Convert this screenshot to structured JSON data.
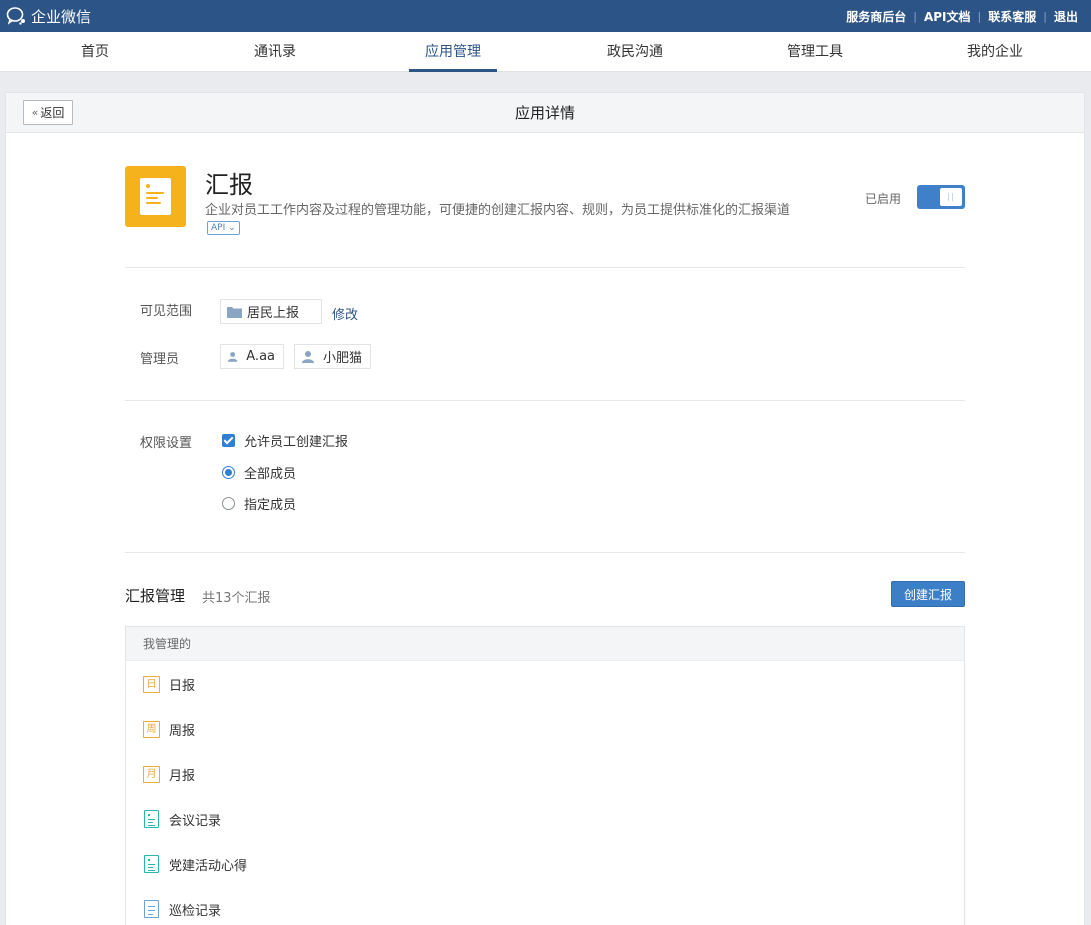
{
  "topbar": {
    "logo_text": "企业微信",
    "links": [
      "服务商后台",
      "API文档",
      "联系客服",
      "退出"
    ]
  },
  "nav": {
    "tabs": [
      "首页",
      "通讯录",
      "应用管理",
      "政民沟通",
      "管理工具",
      "我的企业"
    ],
    "active": "应用管理"
  },
  "page": {
    "back_label": "返回",
    "title": "应用详情"
  },
  "app": {
    "name": "汇报",
    "description": "企业对员工工作内容及过程的管理功能，可便捷的创建汇报内容、规则，为员工提供标准化的汇报渠道",
    "api_tag": "API",
    "status_label": "已启用",
    "enabled": true
  },
  "visibility": {
    "label": "可见范围",
    "scope": "居民上报",
    "modify_label": "修改"
  },
  "admins": {
    "label": "管理员",
    "users": [
      "A.aa",
      "小肥猫"
    ]
  },
  "permissions": {
    "label": "权限设置",
    "allow_create_label": "允许员工创建汇报",
    "allow_create": true,
    "options": [
      "全部成员",
      "指定成员"
    ],
    "selected": "全部成员"
  },
  "reports": {
    "title": "汇报管理",
    "count_text": "共13个汇报",
    "create_label": "创建汇报",
    "group_label": "我管理的",
    "items": [
      {
        "name": "日报",
        "icon": "day-icon",
        "glyph": "日"
      },
      {
        "name": "周报",
        "icon": "week-icon",
        "glyph": "周"
      },
      {
        "name": "月报",
        "icon": "month-icon",
        "glyph": "月"
      },
      {
        "name": "会议记录",
        "icon": "document-icon"
      },
      {
        "name": "党建活动心得",
        "icon": "document-icon"
      },
      {
        "name": "巡检记录",
        "icon": "document-icon"
      }
    ]
  },
  "colors": {
    "header": "#2d5487",
    "accent": "#3d7fc6",
    "app_icon": "#f5b21c",
    "doc_teal": "#27b6b0",
    "doc_blue": "#6aa3dc"
  }
}
